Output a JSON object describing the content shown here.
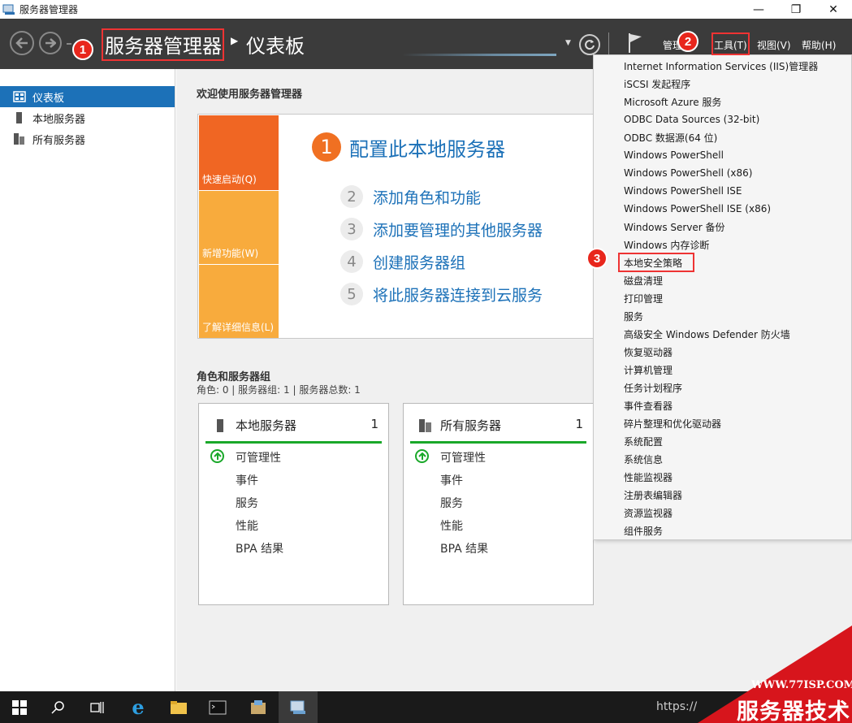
{
  "window": {
    "title": "服务器管理器",
    "controls": [
      "—",
      "❐",
      "✕"
    ]
  },
  "header": {
    "breadcrumb_main": "服务器管理器",
    "breadcrumb_sub": "仪表板",
    "menu_manage": "管理",
    "menu_tools": "工具(T)",
    "menu_view": "视图(V)",
    "menu_help": "帮助(H)"
  },
  "annotations": {
    "badge1": "1",
    "badge2": "2",
    "badge3": "3",
    "highlight_color": "#e33333"
  },
  "sidebar": {
    "items": [
      {
        "label": "仪表板",
        "icon": "dashboard-icon",
        "active": true
      },
      {
        "label": "本地服务器",
        "icon": "server-icon",
        "active": false
      },
      {
        "label": "所有服务器",
        "icon": "servers-icon",
        "active": false
      }
    ]
  },
  "main": {
    "welcome": "欢迎使用服务器管理器",
    "tiles": [
      "快速启动(Q)",
      "新增功能(W)",
      "了解详细信息(L)"
    ],
    "steps": [
      {
        "num": "1",
        "label": "配置此本地服务器"
      },
      {
        "num": "2",
        "label": "添加角色和功能"
      },
      {
        "num": "3",
        "label": "添加要管理的其他服务器"
      },
      {
        "num": "4",
        "label": "创建服务器组"
      },
      {
        "num": "5",
        "label": "将此服务器连接到云服务"
      }
    ],
    "roles_title": "角色和服务器组",
    "roles_summary": "角色: 0 | 服务器组: 1 | 服务器总数: 1",
    "cards": [
      {
        "title": "本地服务器",
        "count": "1",
        "rows": [
          "可管理性",
          "事件",
          "服务",
          "性能",
          "BPA 结果"
        ]
      },
      {
        "title": "所有服务器",
        "count": "1",
        "rows": [
          "可管理性",
          "事件",
          "服务",
          "性能",
          "BPA 结果"
        ]
      }
    ]
  },
  "tools_menu": {
    "items": [
      "Internet Information Services (IIS)管理器",
      "iSCSI 发起程序",
      "Microsoft Azure 服务",
      "ODBC Data Sources (32-bit)",
      "ODBC 数据源(64 位)",
      "Windows PowerShell",
      "Windows PowerShell (x86)",
      "Windows PowerShell ISE",
      "Windows PowerShell ISE (x86)",
      "Windows Server 备份",
      "Windows 内存诊断",
      "本地安全策略",
      "磁盘清理",
      "打印管理",
      "服务",
      "高级安全 Windows Defender 防火墙",
      "恢复驱动器",
      "计算机管理",
      "任务计划程序",
      "事件查看器",
      "碎片整理和优化驱动器",
      "系统配置",
      "系统信息",
      "性能监视器",
      "注册表编辑器",
      "资源监视器",
      "组件服务"
    ],
    "highlighted": "本地安全策略"
  },
  "taskbar": {
    "url_text": "https://"
  },
  "watermark": {
    "url": "WWW.77ISP.COM",
    "text": "服务器技术网"
  }
}
